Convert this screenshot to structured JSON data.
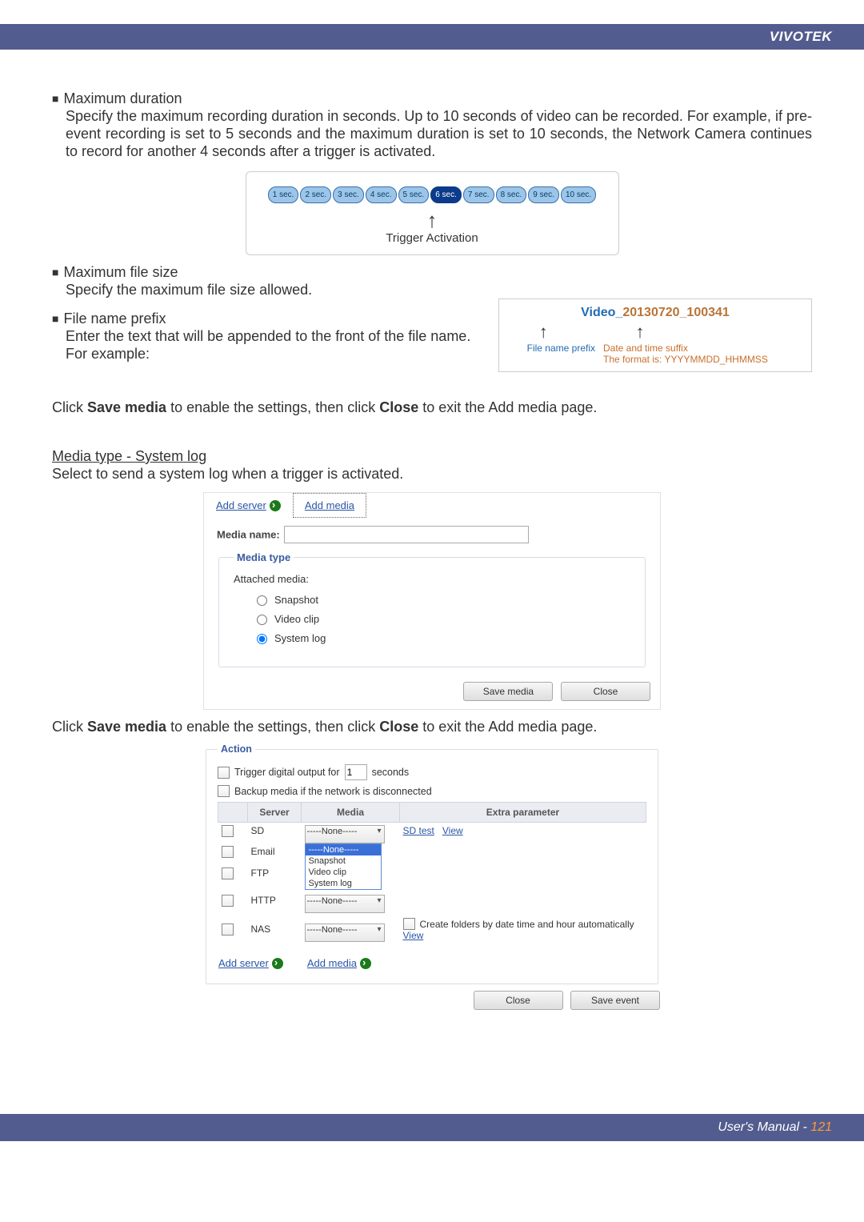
{
  "brand": "VIVOTEK",
  "s1": {
    "title": "Maximum duration",
    "p1": "Specify the maximum recording duration in seconds. Up to 10 seconds of video can be recorded. For example, if pre-event recording is set to 5 seconds and the maximum duration is set to 10 seconds, the Network Camera continues to record for another 4 seconds after a trigger is activated."
  },
  "seconds": [
    "1 sec.",
    "2 sec.",
    "3 sec.",
    "4 sec.",
    "5 sec.",
    "6 sec.",
    "7 sec.",
    "8 sec.",
    "9 sec.",
    "10 sec."
  ],
  "trigger_label": "Trigger Activation",
  "s2": {
    "title": "Maximum file size",
    "p1": "Specify the maximum file size allowed."
  },
  "s3": {
    "title": "File name prefix",
    "p1": "Enter the text that will be appended to the front of the file name.",
    "p2": " For example:"
  },
  "filename": {
    "prefix": "Video_",
    "suffix": "20130720_100341",
    "lbl_prefix": "File name prefix",
    "lbl_suffix1": "Date and time suffix",
    "lbl_suffix2": "The format is: YYYYMMDD_HHMMSS"
  },
  "save_para_a": "Click ",
  "save_para_b": "Save media",
  "save_para_c": " to enable the settings, then click ",
  "save_para_d": "Close",
  "save_para_e": " to exit the Add media page.",
  "syslog_h": "Media type - System log",
  "syslog_p": "Select to send a system log when a trigger is activated.",
  "mediaPanel": {
    "addServer": "Add server",
    "addMedia": "Add media",
    "mediaNameLbl": "Media name:",
    "legend": "Media type",
    "attached": "Attached media:",
    "optSnapshot": "Snapshot",
    "optVideo": "Video clip",
    "optSyslog": "System log",
    "btnSave": "Save media",
    "btnClose": "Close"
  },
  "actionPanel": {
    "legend": "Action",
    "trigA": "Trigger digital output for",
    "trigVal": "1",
    "trigB": "seconds",
    "backup": "Backup media if the network is disconnected",
    "colServer": "Server",
    "colMedia": "Media",
    "colExtra": "Extra parameter",
    "rows": {
      "sd": "SD",
      "email": "Email",
      "ftp": "FTP",
      "http": "HTTP",
      "nas": "NAS"
    },
    "ddNone": "-----None-----",
    "ddOpts": [
      "-----None-----",
      "Snapshot",
      "Video clip",
      "System log"
    ],
    "sdtest": "SD test",
    "view": "View",
    "nasNote": "Create folders by date time and hour automatically",
    "addServer": "Add server",
    "addMedia": "Add media",
    "btnClose": "Close",
    "btnSave": "Save event"
  },
  "footer": {
    "text": "User's Manual - ",
    "page": "121"
  }
}
